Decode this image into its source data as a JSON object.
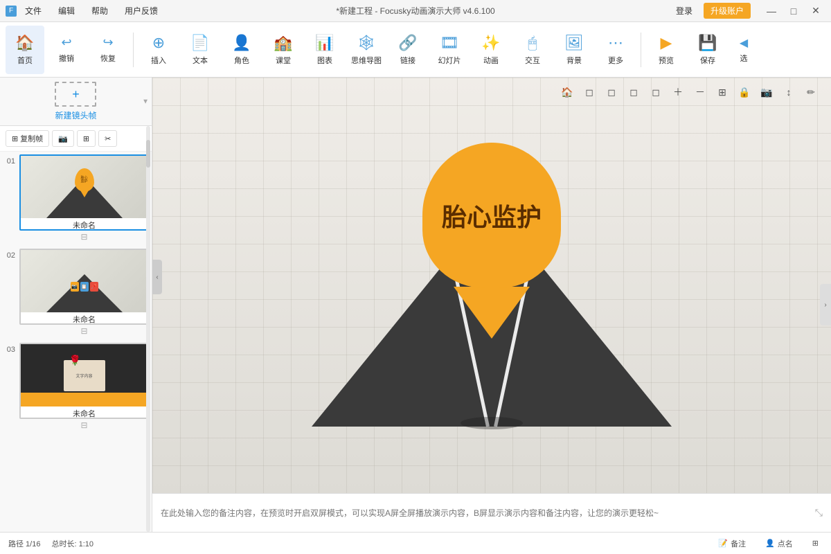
{
  "titlebar": {
    "icon": "F",
    "menu": [
      "文件",
      "编辑",
      "帮助",
      "用户反馈"
    ],
    "title": "*新建工程 - Focusky动画演示大师 v4.6.100",
    "login": "登录",
    "upgrade": "升级账户",
    "min": "—",
    "max": "□",
    "close": "✕"
  },
  "toolbar": {
    "items": [
      {
        "label": "首页",
        "icon": "🏠"
      },
      {
        "label": "撤销",
        "icon": "↩"
      },
      {
        "label": "恢复",
        "icon": "↪"
      },
      {
        "label": "插入",
        "icon": "⊕"
      },
      {
        "label": "文本",
        "icon": "📝"
      },
      {
        "label": "角色",
        "icon": "👤"
      },
      {
        "label": "课堂",
        "icon": "🏫"
      },
      {
        "label": "图表",
        "icon": "📊"
      },
      {
        "label": "思维导图",
        "icon": "🕸"
      },
      {
        "label": "链接",
        "icon": "🔗"
      },
      {
        "label": "幻灯片",
        "icon": "🎞"
      },
      {
        "label": "动画",
        "icon": "✨"
      },
      {
        "label": "交互",
        "icon": "🖱"
      },
      {
        "label": "背景",
        "icon": "🖼"
      },
      {
        "label": "更多",
        "icon": "⋯"
      },
      {
        "label": "预览",
        "icon": "▶"
      },
      {
        "label": "保存",
        "icon": "💾"
      },
      {
        "label": "选",
        "icon": "◀"
      }
    ]
  },
  "left_panel": {
    "new_frame_label": "新建镜头帧",
    "frame_actions": [
      "复制帧",
      "📷",
      "⊞",
      "✂"
    ],
    "slides": [
      {
        "number": "01",
        "name": "未命名",
        "active": true
      },
      {
        "number": "02",
        "name": "未命名",
        "active": false
      },
      {
        "number": "03",
        "name": "未命名",
        "active": false
      }
    ]
  },
  "canvas": {
    "pin_text": "胎心监护",
    "page_counter": "01/16"
  },
  "canvas_toolbar_icons": [
    "🏠",
    "◻",
    "◻",
    "◻",
    "◻",
    "+",
    "−",
    "⊞",
    "🔒",
    "📷",
    "↕",
    "✏"
  ],
  "notes": {
    "placeholder": "在此处输入您的备注内容，在预览时开启双屏模式，可以实现A屏全屏播放演示内容，B屏显示演示内容和备注内容，让您的演示更轻松~"
  },
  "status_bar": {
    "path": "路径 1/16",
    "duration": "总时长: 1:10",
    "notes_label": "备注",
    "callname_label": "点名"
  }
}
